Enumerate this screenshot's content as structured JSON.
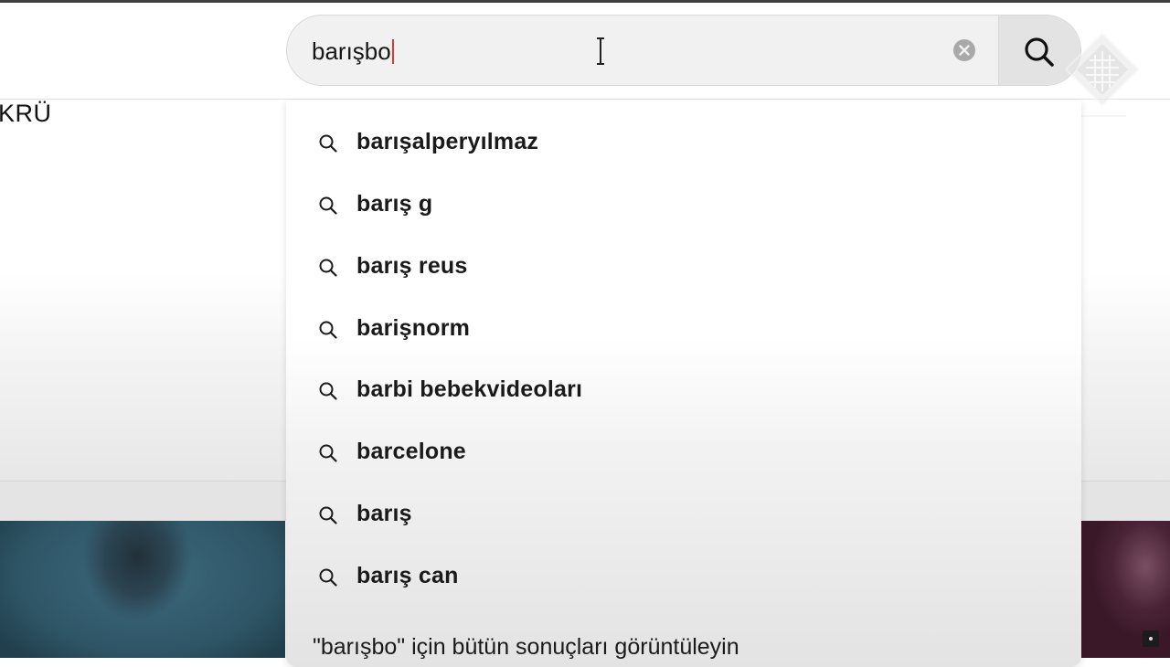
{
  "page": {
    "left_heading": "KRÜ"
  },
  "search": {
    "value": "barışbo",
    "clear_icon": "clear-x-icon",
    "submit_icon": "search-icon"
  },
  "suggestions": [
    {
      "text": "barışalperyılmaz",
      "icon": "search-icon"
    },
    {
      "text": "barış g",
      "icon": "search-icon"
    },
    {
      "text": "barış reus",
      "icon": "search-icon"
    },
    {
      "text": "barişnorm",
      "icon": "search-icon"
    },
    {
      "text": "barbi bebekvideoları",
      "icon": "search-icon"
    },
    {
      "text": "barcelone",
      "icon": "search-icon"
    },
    {
      "text": "barış",
      "icon": "search-icon"
    },
    {
      "text": "barış can",
      "icon": "search-icon"
    }
  ],
  "all_results_text": "\"barışbo\" için bütün sonuçları görüntüleyin",
  "colors": {
    "caret": "#e03a2c",
    "search_box_bg": "#f1f1f1",
    "text": "#1a1a1a"
  }
}
